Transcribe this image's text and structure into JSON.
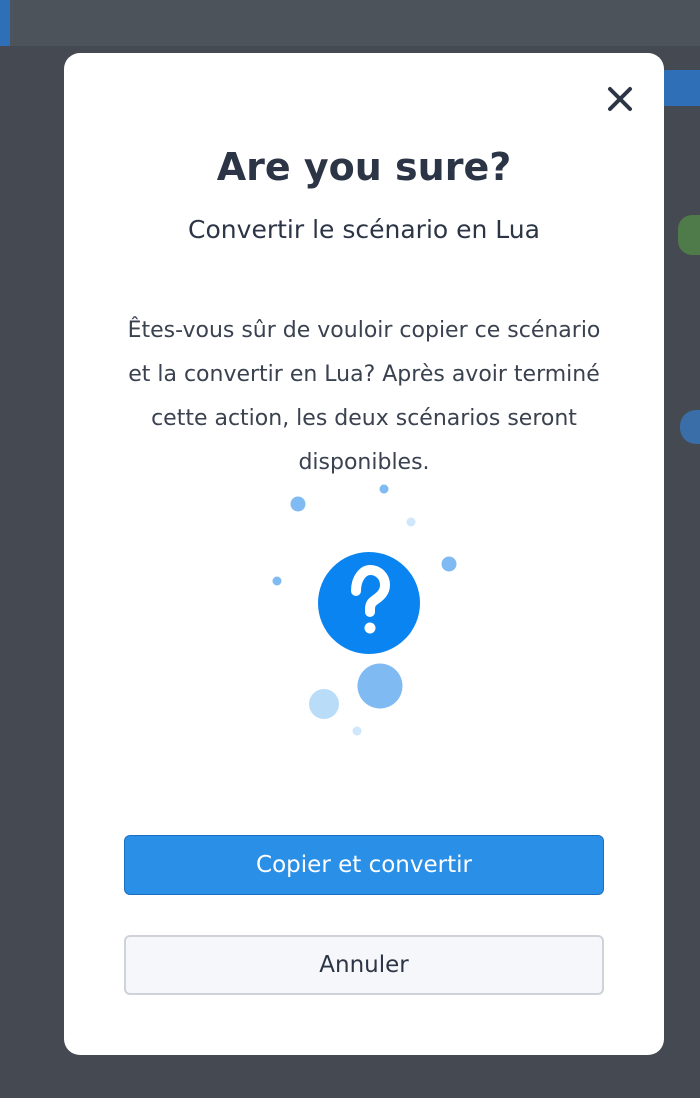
{
  "dialog": {
    "title": "Are you sure?",
    "subtitle": "Convertir le scénario en Lua",
    "description": "Êtes-vous sûr de vouloir copier ce scénario et la convertir en Lua? Après avoir terminé cette action, les deux scénarios seront disponibles.",
    "illustration_icon": "question-mark-icon",
    "close_icon": "close-icon",
    "confirm_label": "Copier et convertir",
    "cancel_label": "Annuler"
  },
  "colors": {
    "overlay": "#454a52",
    "modal_bg": "#ffffff",
    "title_text": "#2c3545",
    "primary_button": "#2a8fe6",
    "question_circle": "#0a84f0",
    "bubble_light": "#b9dcf8",
    "bubble_mid": "#7fbaf2"
  }
}
